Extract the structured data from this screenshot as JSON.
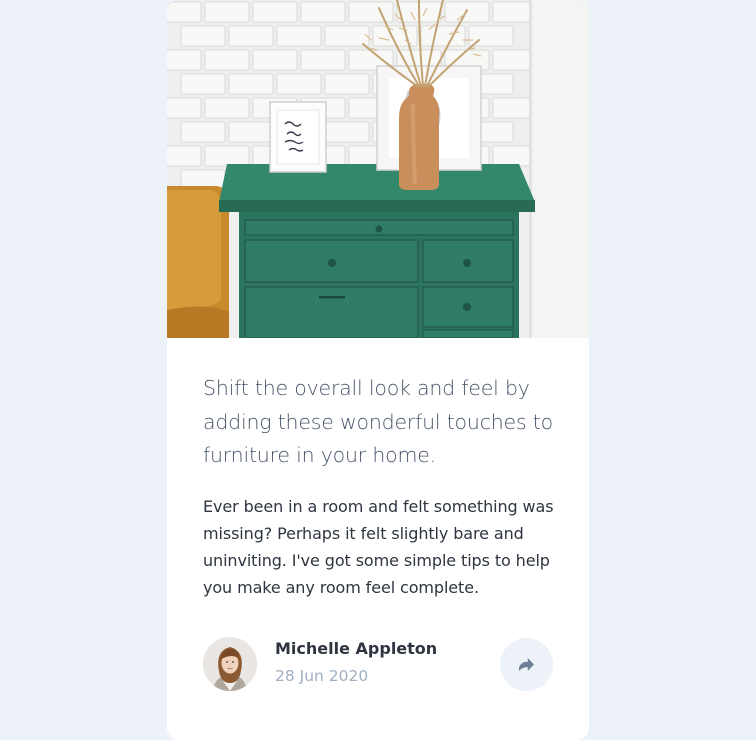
{
  "article": {
    "title": "Shift the overall look and feel by adding these wonderful touches to furniture in your home.",
    "description": "Ever been in a room and felt something was missing? Perhaps it felt slightly bare and uninviting. I've got some simple tips to help you make any room feel complete.",
    "image_icon": "drawers-photo"
  },
  "author": {
    "name": "Michelle Appleton",
    "date": "28 Jun 2020",
    "avatar_icon": "avatar-photo"
  },
  "share": {
    "icon": "share-icon"
  },
  "colors": {
    "background": "#ECF2F8",
    "card": "#FFFFFF",
    "title_text": "#48556A",
    "body_text": "#2E3540",
    "muted_text": "#9EAFC2",
    "cabinet_green": "#2F7A61"
  }
}
